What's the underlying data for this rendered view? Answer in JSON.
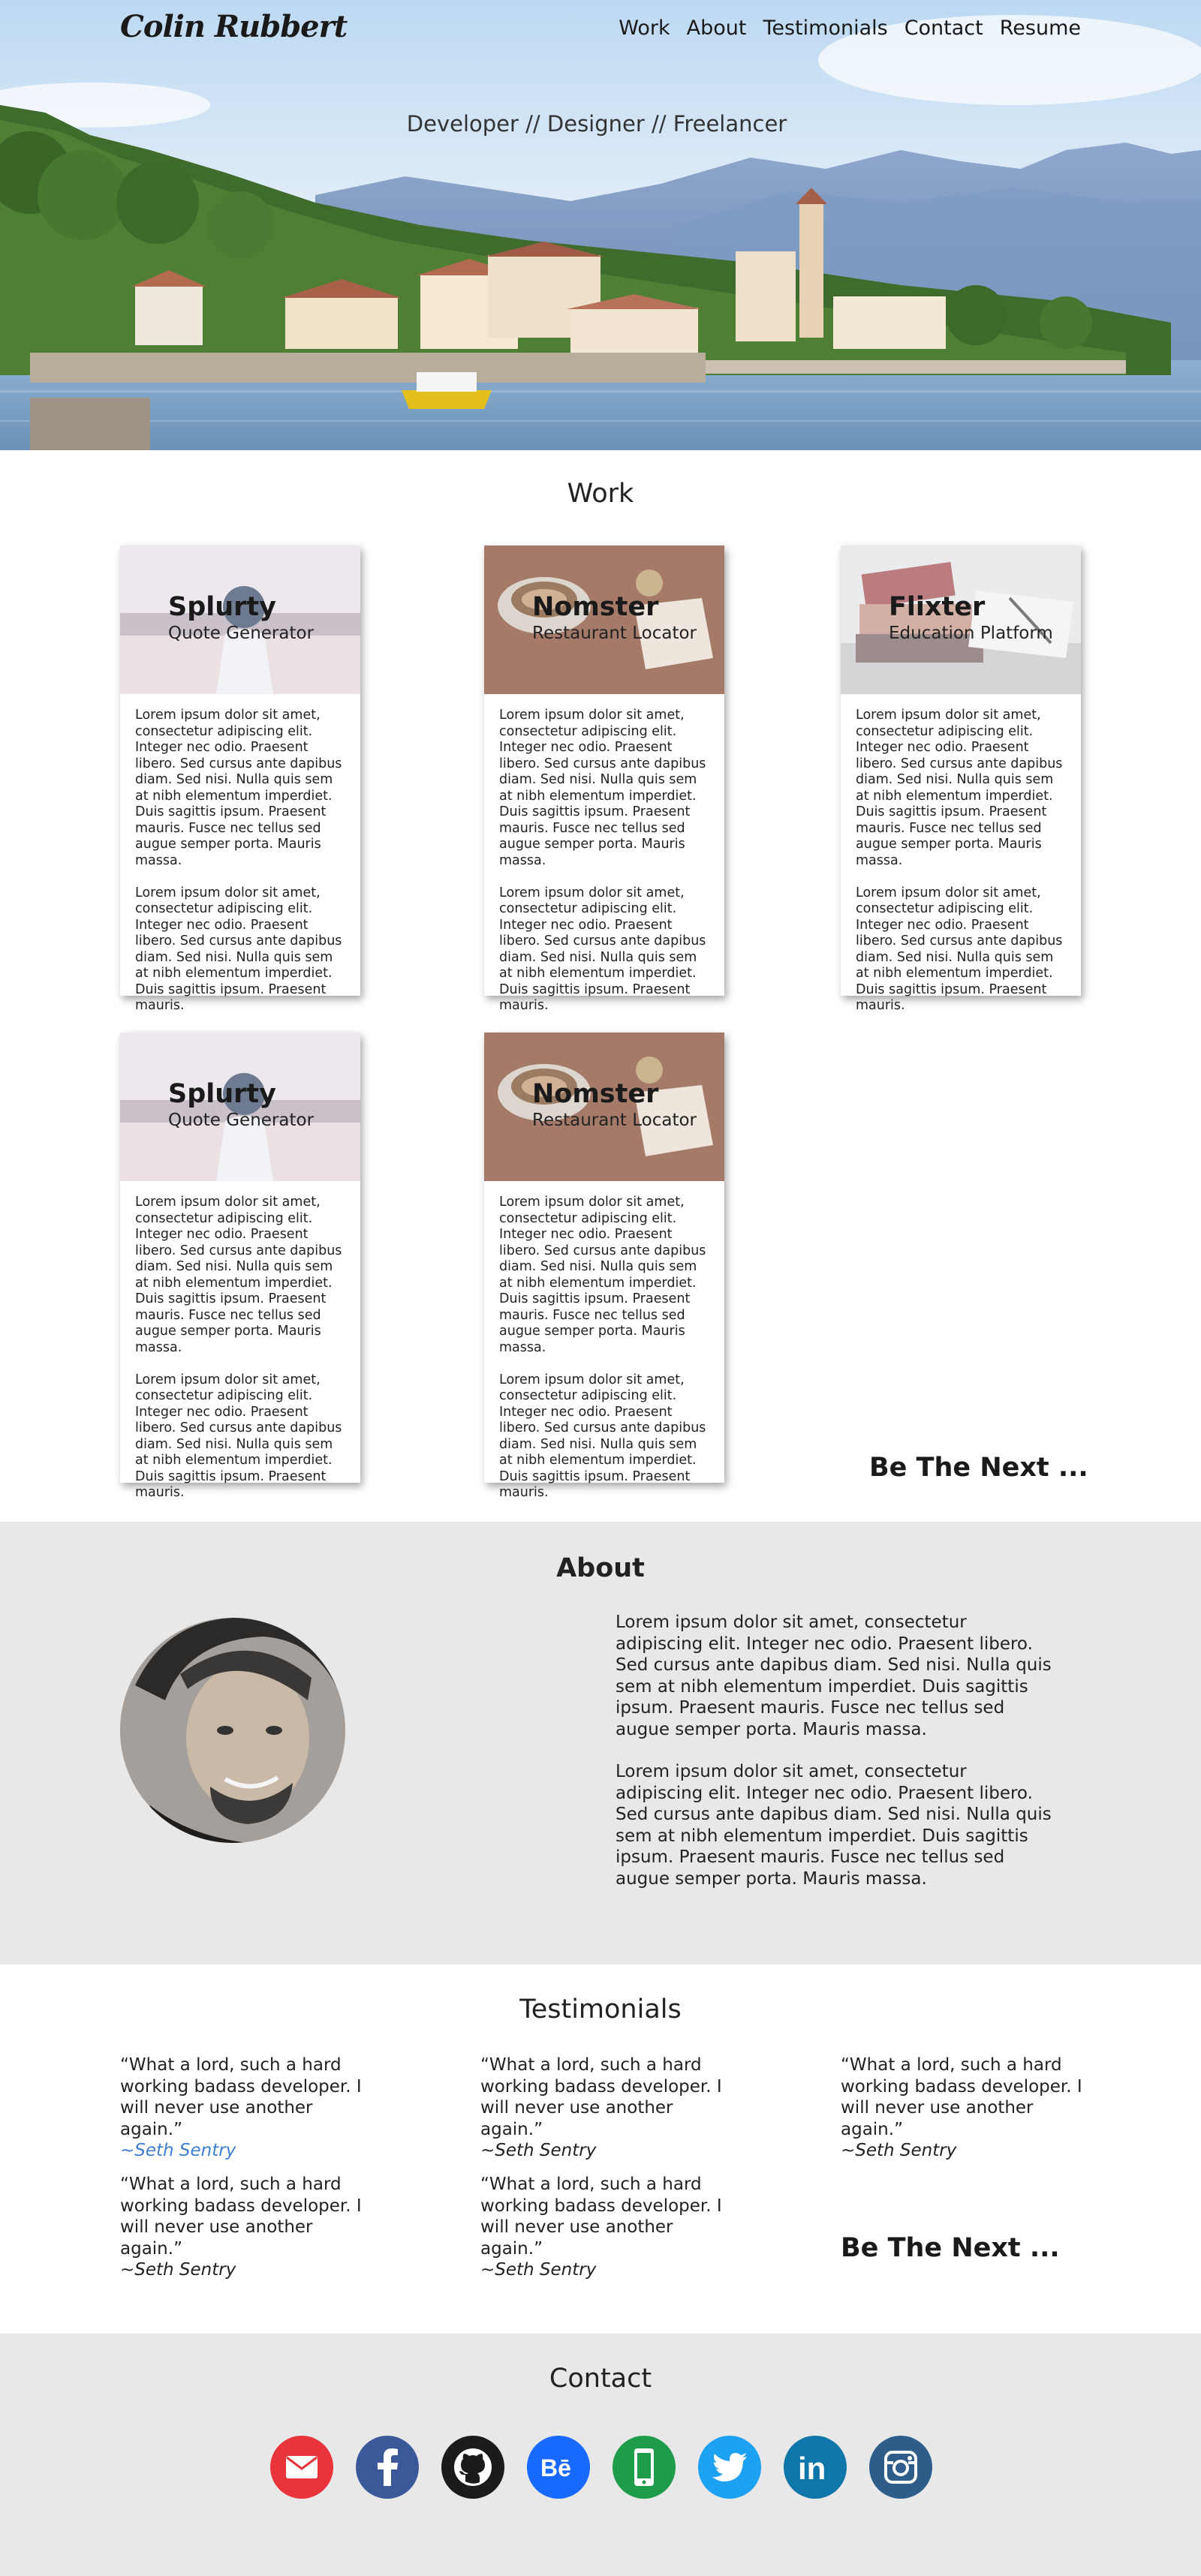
{
  "nav": {
    "brand": "Colin Rubbert",
    "links": [
      "Work",
      "About",
      "Testimonials",
      "Contact",
      "Resume"
    ]
  },
  "hero": {
    "tagline": "Developer // Designer // Freelancer"
  },
  "work": {
    "title": "Work",
    "paragraph1": "Lorem ipsum dolor sit amet, consectetur adipiscing elit. Integer nec odio. Praesent libero. Sed cursus ante dapibus diam. Sed nisi. Nulla quis sem at nibh elementum imperdiet. Duis sagittis ipsum. Praesent mauris. Fusce nec tellus sed augue semper porta. Mauris massa.",
    "paragraph2": "Lorem ipsum dolor sit amet, consectetur adipiscing elit. Integer nec odio. Praesent libero. Sed cursus ante dapibus diam. Sed nisi. Nulla quis sem at nibh elementum imperdiet. Duis sagittis ipsum. Praesent mauris.",
    "cards": [
      {
        "title": "Splurty",
        "subtitle": "Quote Generator"
      },
      {
        "title": "Nomster",
        "subtitle": "Restaurant Locator"
      },
      {
        "title": "Flixter",
        "subtitle": "Education Platform"
      },
      {
        "title": "Splurty",
        "subtitle": "Quote Generator"
      },
      {
        "title": "Nomster",
        "subtitle": "Restaurant Locator"
      }
    ],
    "next": "Be The Next ..."
  },
  "about": {
    "title": "About",
    "paragraph1": "Lorem ipsum dolor sit amet, consectetur adipiscing elit. Integer nec odio. Praesent libero. Sed cursus ante dapibus diam. Sed nisi. Nulla quis sem at nibh elementum imperdiet. Duis sagittis ipsum. Praesent mauris. Fusce nec tellus sed augue semper porta. Mauris massa.",
    "paragraph2": "Lorem ipsum dolor sit amet, consectetur adipiscing elit. Integer nec odio. Praesent libero. Sed cursus ante dapibus diam. Sed nisi. Nulla quis sem at nibh elementum imperdiet. Duis sagittis ipsum. Praesent mauris. Fusce nec tellus sed augue semper porta. Mauris massa."
  },
  "testimonials": {
    "title": "Testimonials",
    "quote": "“What a lord, such a hard working badass developer. I will never use another again.”",
    "author": "~Seth Sentry",
    "next": "Be The Next ..."
  },
  "contact": {
    "title": "Contact",
    "icons": [
      "email-icon",
      "facebook-icon",
      "github-icon",
      "behance-icon",
      "phone-icon",
      "twitter-icon",
      "linkedin-icon",
      "instagram-icon"
    ]
  },
  "colors": {
    "section_gray": "#e8e8e8",
    "link_blue": "#3f7fd0",
    "email_red": "#e8343a",
    "facebook_blue": "#3b5998",
    "github_black": "#1b1b1b",
    "behance_blue": "#1769ff",
    "phone_green": "#1e9c4a",
    "twitter_blue": "#1da1f2",
    "linkedin_blue": "#0e76a8",
    "instagram_blue": "#2f5d8a"
  }
}
